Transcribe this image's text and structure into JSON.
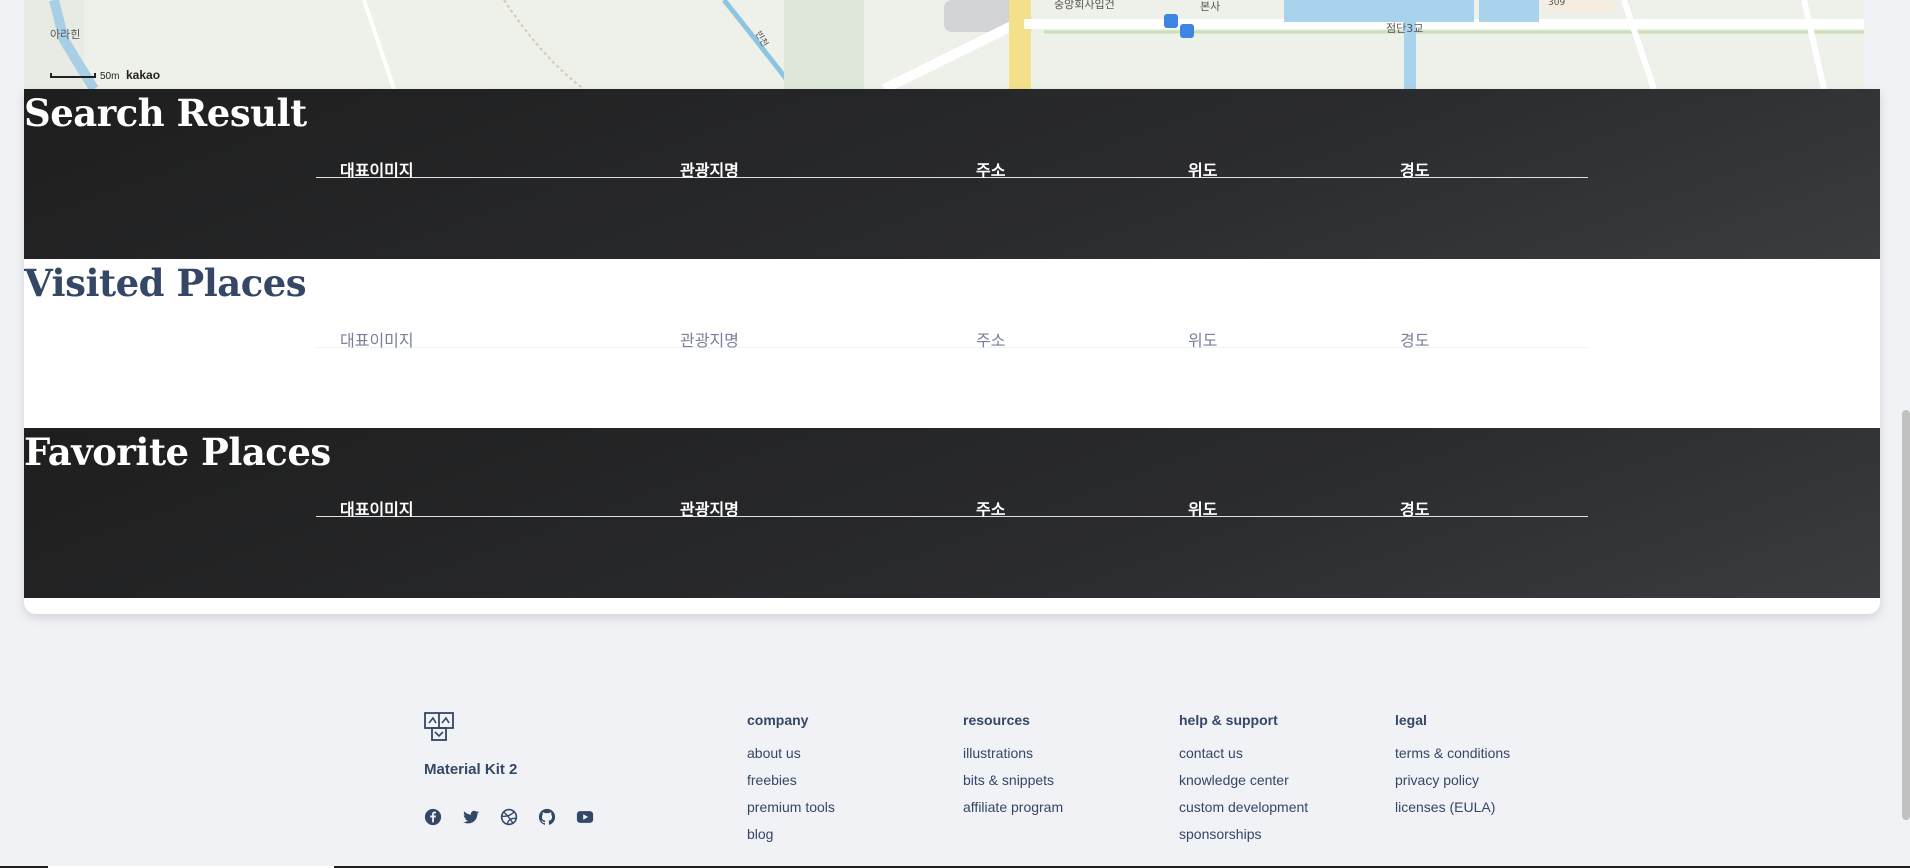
{
  "map": {
    "labels": [
      "아라힌",
      "중앙회사입건",
      "본사",
      "점단3교",
      "309",
      "빈천"
    ],
    "scale_text": "50m",
    "provider": "kakao"
  },
  "sections": [
    {
      "title": "Search Result",
      "theme": "dark"
    },
    {
      "title": "Visited Places",
      "theme": "light"
    },
    {
      "title": "Favorite Places",
      "theme": "dark"
    }
  ],
  "table_columns": [
    "대표이미지",
    "관광지명",
    "주소",
    "위도",
    "경도"
  ],
  "footer": {
    "brand_name": "Material Kit 2",
    "social_icons": [
      "facebook-icon",
      "twitter-icon",
      "dribbble-icon",
      "github-icon",
      "youtube-icon"
    ],
    "columns": [
      {
        "heading": "company",
        "links": [
          "about us",
          "freebies",
          "premium tools",
          "blog"
        ]
      },
      {
        "heading": "resources",
        "links": [
          "illustrations",
          "bits & snippets",
          "affiliate program"
        ]
      },
      {
        "heading": "help & support",
        "links": [
          "contact us",
          "knowledge center",
          "custom development",
          "sponsorships"
        ]
      },
      {
        "heading": "legal",
        "links": [
          "terms & conditions",
          "privacy policy",
          "licenses (EULA)"
        ]
      }
    ]
  },
  "colors": {
    "dark_bg": "#1e1e1e",
    "light_title": "#344767",
    "muted": "#7b809a",
    "page_bg": "#f0f2f5"
  }
}
